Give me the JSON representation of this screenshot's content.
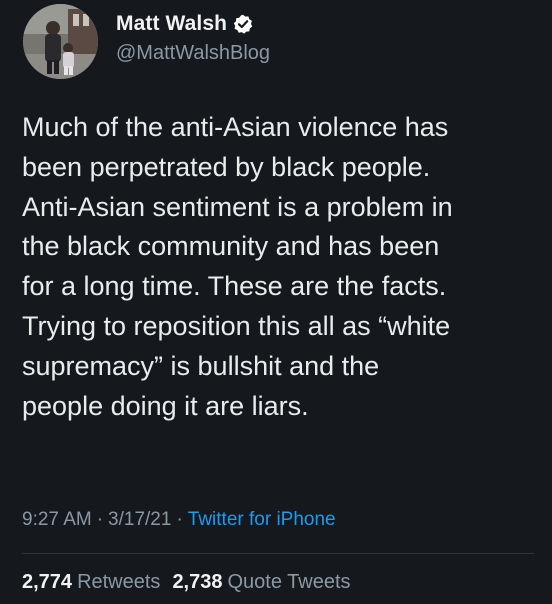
{
  "author": {
    "display_name": "Matt Walsh",
    "handle": "@MattWalshBlog",
    "verified": true,
    "avatar_icon": "profile-photo"
  },
  "tweet": {
    "text": "Much of the anti-Asian violence has\nbeen perpetrated by black people.\nAnti-Asian sentiment is a problem in\nthe black community and has been\nfor a long time. These are the facts.\nTrying to reposition this all as “white\nsupremacy” is bullshit and the\npeople doing it are liars.",
    "time": "9:27 AM",
    "separator": "·",
    "date": "3/17/21",
    "source": "Twitter for iPhone"
  },
  "stats": {
    "retweets_count": "2,774",
    "retweets_label": "Retweets",
    "quote_tweets_count": "2,738",
    "quote_tweets_label": "Quote Tweets"
  },
  "colors": {
    "background": "#15181c",
    "text": "#e9ebec",
    "secondary": "#8b98a5",
    "link": "#1d9bf0",
    "verified": "#ffffff"
  }
}
